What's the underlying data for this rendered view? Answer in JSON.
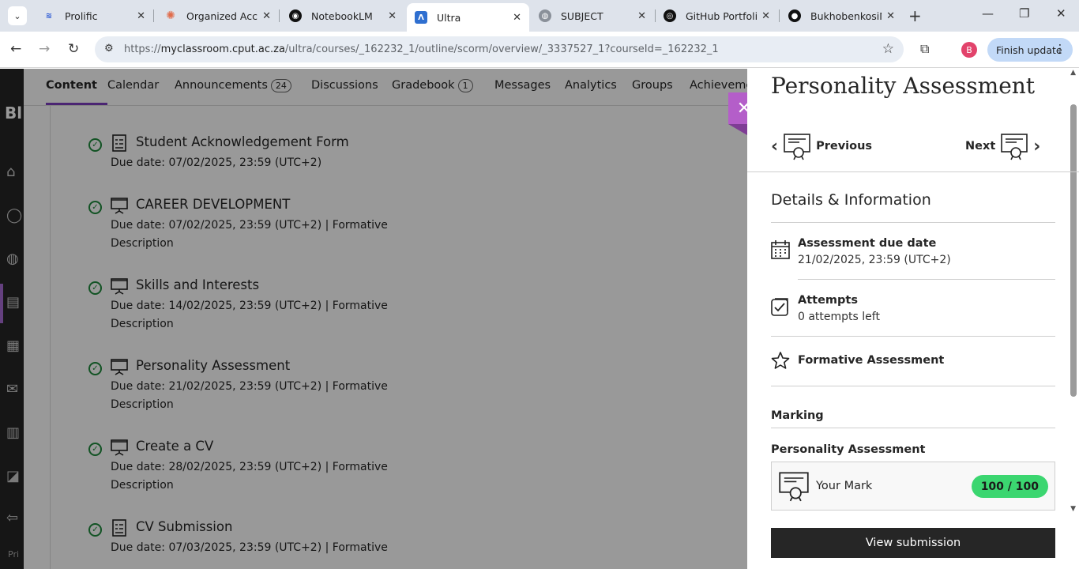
{
  "browser": {
    "tabs": [
      {
        "title": "Prolific",
        "fav_color": "#2857d4",
        "fav_glyph": "≋"
      },
      {
        "title": "Organized Acco",
        "fav_color": "#e06c4b",
        "fav_glyph": "✺"
      },
      {
        "title": "NotebookLM",
        "fav_color": "#111111",
        "fav_glyph": "◉"
      },
      {
        "title": "Ultra",
        "fav_color": "#2f6fd0",
        "fav_glyph": "Λ"
      },
      {
        "title": "SUBJECT",
        "fav_color": "#5f6368",
        "fav_glyph": "◍"
      },
      {
        "title": "GitHub Portfolio",
        "fav_color": "#111111",
        "fav_glyph": "◎"
      },
      {
        "title": "BukhobenkosiM",
        "fav_color": "#111111",
        "fav_glyph": "●"
      }
    ],
    "url_prefix": "https://",
    "url_host": "myclassroom.cput.ac.za",
    "url_path": "/ultra/courses/_162232_1/outline/scorm/overview/_3337527_1?courseId=_162232_1",
    "profile_initial": "B",
    "finish_update": "Finish update"
  },
  "sidebar": {
    "logo": "Bl",
    "footer": "Pri"
  },
  "course_tabs": {
    "content": "Content",
    "calendar": "Calendar",
    "announcements": "Announcements",
    "announcements_count": "24",
    "discussions": "Discussions",
    "gradebook": "Gradebook",
    "gradebook_count": "1",
    "messages": "Messages",
    "analytics": "Analytics",
    "groups": "Groups",
    "achievements": "Achieveme"
  },
  "content_items": [
    {
      "title": "Student Acknowledgement Form",
      "meta": "Due date: 07/02/2025, 23:59 (UTC+2)",
      "desc": "",
      "icon": "form-icon"
    },
    {
      "title": "CAREER DEVELOPMENT",
      "meta": "Due date: 07/02/2025, 23:59 (UTC+2)  |  Formative",
      "desc": "Description",
      "icon": "presentation-icon"
    },
    {
      "title": "Skills and Interests",
      "meta": "Due date: 14/02/2025, 23:59 (UTC+2)  |  Formative",
      "desc": "Description",
      "icon": "presentation-icon"
    },
    {
      "title": "Personality Assessment",
      "meta": "Due date: 21/02/2025, 23:59 (UTC+2)  |  Formative",
      "desc": "Description",
      "icon": "presentation-icon"
    },
    {
      "title": "Create a CV",
      "meta": "Due date: 28/02/2025, 23:59 (UTC+2)  |  Formative",
      "desc": "Description",
      "icon": "presentation-icon"
    },
    {
      "title": "CV Submission",
      "meta": "Due date: 07/03/2025, 23:59 (UTC+2)  |  Formative",
      "desc": "",
      "icon": "form-icon"
    }
  ],
  "panel": {
    "title": "Personality Assessment",
    "previous": "Previous",
    "next": "Next",
    "section_title": "Details & Information",
    "due_label": "Assessment due date",
    "due_value": "21/02/2025, 23:59 (UTC+2)",
    "attempts_label": "Attempts",
    "attempts_value": "0 attempts left",
    "formative_label": "Formative Assessment",
    "marking_label": "Marking",
    "mark_item_label": "Personality Assessment",
    "your_mark_label": "Your Mark",
    "mark_value": "100 / 100",
    "view_submission": "View submission"
  }
}
